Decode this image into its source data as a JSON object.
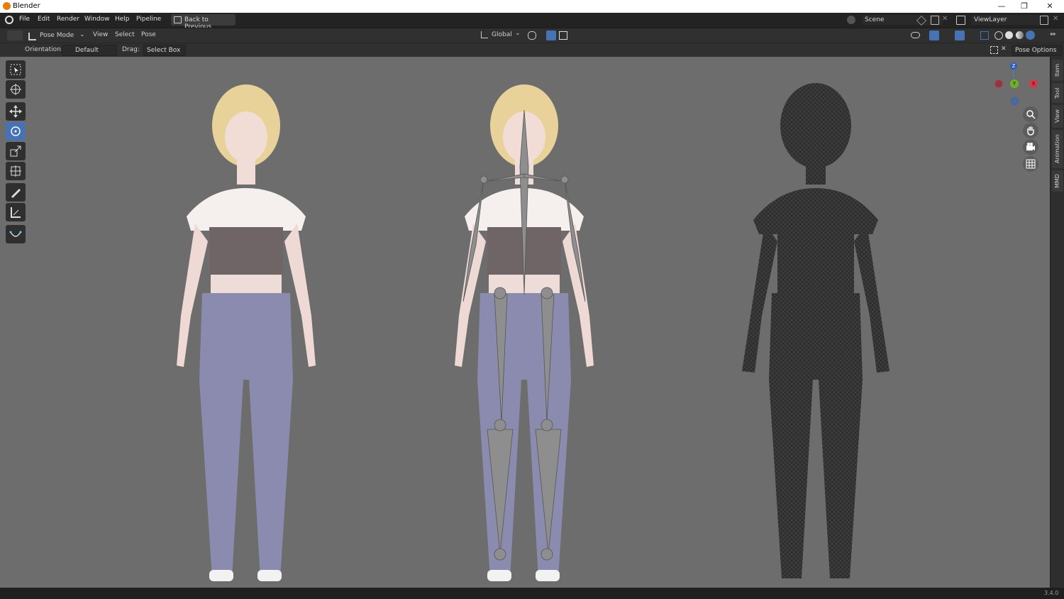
{
  "titlebar": {
    "title": "Blender",
    "minimize": "—",
    "restore": "❐",
    "close": "✕"
  },
  "menu": {
    "items": [
      "File",
      "Edit",
      "Render",
      "Window",
      "Help",
      "Pipeline"
    ],
    "back_button": "Back to Previous",
    "scene_label": "Scene",
    "viewlayer_label": "ViewLayer"
  },
  "header": {
    "mode": "Pose Mode",
    "menus": [
      "View",
      "Select",
      "Pose"
    ],
    "transform_orientation": "Global"
  },
  "tool_settings": {
    "orientation_label": "Orientation:",
    "orientation_value": "Default",
    "drag_label": "Drag:",
    "drag_value": "Select Box",
    "pose_options": "Pose Options"
  },
  "gizmo": {
    "z": "Z",
    "y": "Y",
    "x": "X"
  },
  "npanel_tabs": [
    "Item",
    "Tool",
    "View",
    "Animation",
    "MMD"
  ],
  "toolbar": [
    "select-box-icon",
    "cursor-icon",
    "move-icon",
    "rotate-icon",
    "scale-icon",
    "transform-icon",
    "annotate-icon",
    "measure-icon",
    "curve-icon"
  ],
  "status": {
    "version": "3.4.0"
  },
  "colors": {
    "accent": "#4772b3",
    "viewport_bg": "#6d6d6d",
    "header_bg": "#303030"
  }
}
